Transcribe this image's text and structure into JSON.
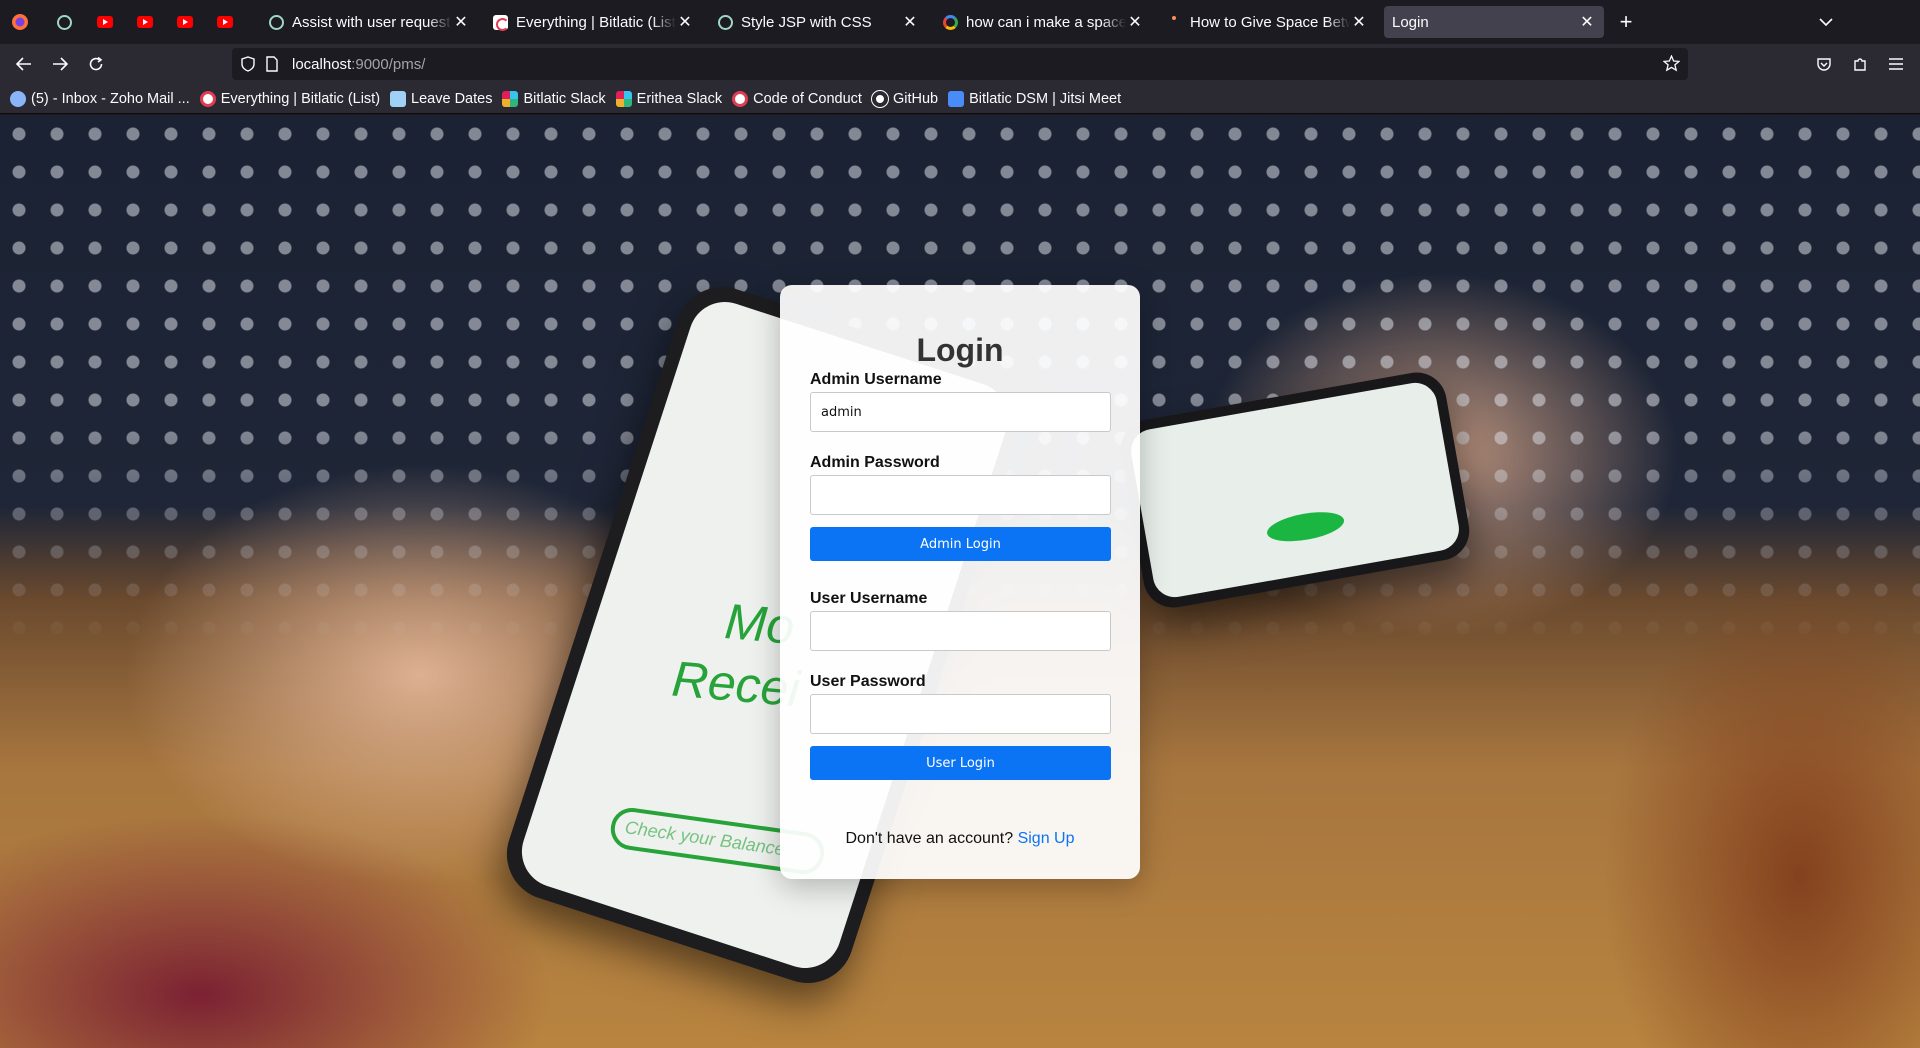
{
  "browser": {
    "pinned_tabs": [
      "chatgpt-icon",
      "youtube-icon",
      "youtube-icon",
      "youtube-icon",
      "youtube-icon"
    ],
    "tabs": [
      {
        "title": "Assist with user request",
        "icon": "chatgpt-icon"
      },
      {
        "title": "Everything | Bitlatic (List)",
        "icon": "clickup-icon"
      },
      {
        "title": "Style JSP with CSS",
        "icon": "chatgpt-icon"
      },
      {
        "title": "how can i make a space between",
        "icon": "google-icon"
      },
      {
        "title": "How to Give Space Between",
        "icon": "dot-icon"
      },
      {
        "title": "Login",
        "icon": "none",
        "active": true
      }
    ],
    "url": {
      "host": "localhost",
      "rest": ":9000/pms/"
    },
    "bookmarks": [
      {
        "label": "(5) - Inbox - Zoho Mail ...",
        "icon": "zoho-icon",
        "color": "#8ab4f8"
      },
      {
        "label": "Everything | Bitlatic (List)",
        "icon": "clickup-icon",
        "color": "#e03d55"
      },
      {
        "label": "Leave Dates",
        "icon": "sheet-icon",
        "color": "#9fd0f5"
      },
      {
        "label": "Bitlatic Slack",
        "icon": "slack-icon",
        "color": "#e01e5a"
      },
      {
        "label": "Erithea Slack",
        "icon": "slack-icon",
        "color": "#36c5f0"
      },
      {
        "label": "Code of Conduct",
        "icon": "clickup-icon",
        "color": "#e03d55"
      },
      {
        "label": "GitHub",
        "icon": "github-icon",
        "color": "#ffffff"
      },
      {
        "label": "Bitlatic DSM | Jitsi Meet",
        "icon": "jitsi-icon",
        "color": "#4a8cf7"
      }
    ]
  },
  "login": {
    "title": "Login",
    "admin_username_label": "Admin Username",
    "admin_username_value": "admin",
    "admin_password_label": "Admin Password",
    "admin_login_button": "Admin Login",
    "user_username_label": "User Username",
    "user_password_label": "User Password",
    "user_login_button": "User Login",
    "signup_prompt": "Don't have an account?",
    "signup_link": "Sign Up"
  },
  "background": {
    "phone_text_1": "Mo",
    "phone_text_2": "Recei",
    "phone_pill": "Check your Balance"
  },
  "colors": {
    "accent": "#0b74f5",
    "tab_active": "#42414d",
    "chrome": "#2b2a33"
  }
}
